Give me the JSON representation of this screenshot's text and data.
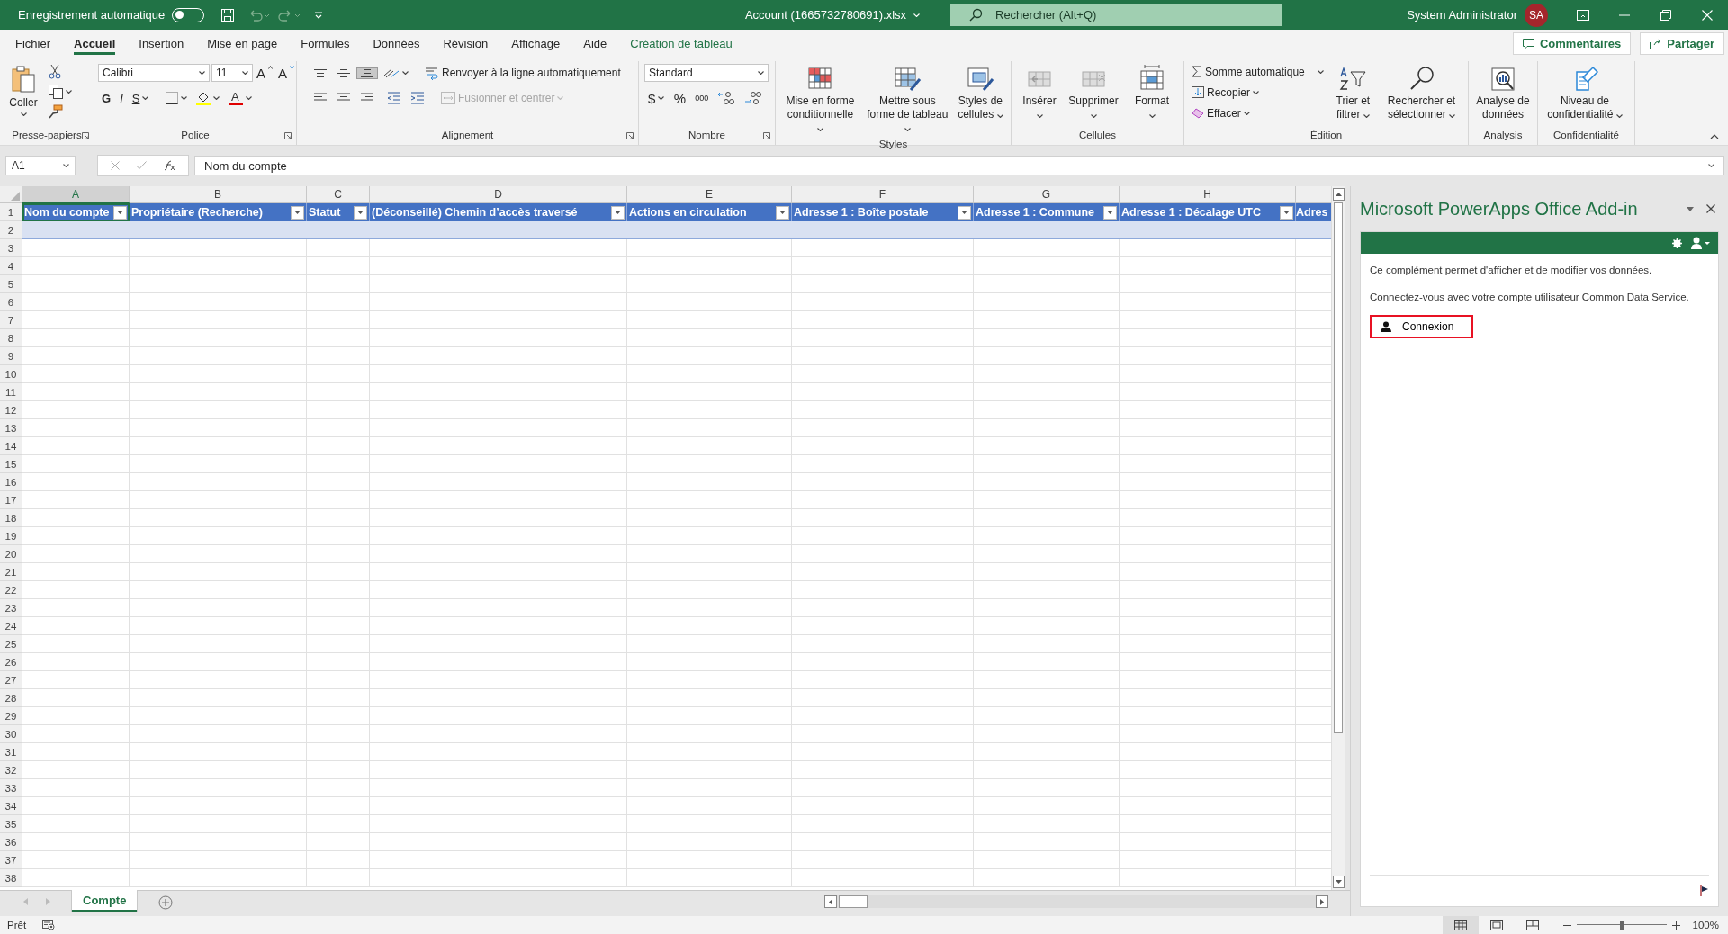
{
  "title_bar": {
    "autosave_label": "Enregistrement automatique",
    "autosave_on": false,
    "file_name": "Account (1665732780691).xlsx",
    "search_placeholder": "Rechercher (Alt+Q)",
    "user_name": "System Administrator",
    "user_initials": "SA"
  },
  "menu_tabs": [
    {
      "label": "Fichier",
      "selected": false,
      "contextual": false
    },
    {
      "label": "Accueil",
      "selected": true,
      "contextual": false
    },
    {
      "label": "Insertion",
      "selected": false,
      "contextual": false
    },
    {
      "label": "Mise en page",
      "selected": false,
      "contextual": false
    },
    {
      "label": "Formules",
      "selected": false,
      "contextual": false
    },
    {
      "label": "Données",
      "selected": false,
      "contextual": false
    },
    {
      "label": "Révision",
      "selected": false,
      "contextual": false
    },
    {
      "label": "Affichage",
      "selected": false,
      "contextual": false
    },
    {
      "label": "Aide",
      "selected": false,
      "contextual": false
    },
    {
      "label": "Création de tableau",
      "selected": false,
      "contextual": true
    }
  ],
  "comments_button": "Commentaires",
  "share_button": "Partager",
  "ribbon": {
    "clipboard": {
      "label": "Presse-papiers",
      "paste": "Coller"
    },
    "font": {
      "label": "Police",
      "font_name": "Calibri",
      "font_size": "11",
      "grow": "A",
      "shrink": "A",
      "bold": "G",
      "italic": "I",
      "underline": "S",
      "font_color": "A"
    },
    "alignment": {
      "label": "Alignement",
      "vertical": [
        {
          "selected": false
        },
        {
          "selected": false
        },
        {
          "selected": true
        }
      ],
      "wrap": "Renvoyer à la ligne automatiquement",
      "merge": "Fusionner et centrer",
      "merge_disabled": true
    },
    "number": {
      "label": "Nombre",
      "format": "Standard",
      "currency": "$",
      "percent": "%",
      "thousands": "000"
    },
    "styles": {
      "label": "Styles",
      "buttons": [
        {
          "kind": "conditional",
          "label": "Mise en forme conditionnelle",
          "menu": true
        },
        {
          "kind": "table",
          "label": "Mettre sous forme de tableau",
          "menu": true
        },
        {
          "kind": "cellstyles",
          "label": "Styles de cellules",
          "menu": true
        }
      ]
    },
    "cells": {
      "label": "Cellules",
      "buttons": [
        {
          "kind": "insert",
          "label": "Insérer",
          "menu": true
        },
        {
          "kind": "delete",
          "label": "Supprimer",
          "menu": true
        },
        {
          "kind": "format",
          "label": "Format",
          "menu": true
        }
      ]
    },
    "editing": {
      "label": "Édition",
      "autosum": "Somme automatique",
      "fill": "Recopier",
      "clear": "Effacer",
      "buttons": [
        {
          "kind": "sort",
          "label": "Trier et filtrer",
          "menu": true
        },
        {
          "kind": "find",
          "label": "Rechercher et sélectionner",
          "menu": true
        }
      ]
    },
    "analysis": {
      "label": "Analysis",
      "buttons": [
        {
          "kind": "analyze",
          "label": "Analyse de données",
          "menu": false
        }
      ]
    },
    "sensitivity": {
      "label": "Confidentialité",
      "buttons": [
        {
          "kind": "sensitivity",
          "label": "Niveau de confidentialité",
          "menu": true
        }
      ]
    }
  },
  "formula_bar": {
    "name_box": "A1",
    "formula": "Nom du compte"
  },
  "sheet": {
    "columns": [
      {
        "letter": "A",
        "header": "Nom du compte",
        "selected": true
      },
      {
        "letter": "B",
        "header": "Propriétaire (Recherche)",
        "selected": false
      },
      {
        "letter": "C",
        "header": "Statut",
        "selected": false
      },
      {
        "letter": "D",
        "header": "(Déconseillé) Chemin d’accès traversé",
        "selected": false
      },
      {
        "letter": "E",
        "header": "Actions en circulation",
        "selected": false
      },
      {
        "letter": "F",
        "header": "Adresse 1 : Boîte postale",
        "selected": false
      },
      {
        "letter": "G",
        "header": "Adresse 1 : Commune",
        "selected": false
      },
      {
        "letter": "H",
        "header": "Adresse 1 : Décalage UTC",
        "selected": false
      },
      {
        "header": "Adres",
        "selected": false
      }
    ],
    "row_numbers": [
      "1",
      "2",
      "3",
      "4",
      "5",
      "6",
      "7",
      "8",
      "9",
      "10",
      "11",
      "12",
      "13",
      "14",
      "15",
      "16",
      "17",
      "18",
      "19",
      "20",
      "21",
      "22",
      "23",
      "24",
      "25",
      "26",
      "27",
      "28",
      "29",
      "30",
      "31",
      "32",
      "33",
      "34",
      "35",
      "36",
      "37",
      "38"
    ]
  },
  "sheet_tabs": [
    {
      "label": "Compte",
      "selected": true
    }
  ],
  "pane": {
    "title": "Microsoft PowerApps Office Add-in",
    "description": "Ce complément permet d'afficher et de modifier vos données.",
    "prompt": "Connectez-vous avec votre compte utilisateur Common Data Service.",
    "sign_in": "Connexion"
  },
  "status_bar": {
    "ready": "Prêt",
    "views": [
      {
        "kind": "normal",
        "selected": true
      },
      {
        "kind": "page_layout",
        "selected": false
      },
      {
        "kind": "page_break",
        "selected": false
      }
    ],
    "zoom_slider": {
      "level": 0.5
    },
    "zoom": "100%"
  }
}
